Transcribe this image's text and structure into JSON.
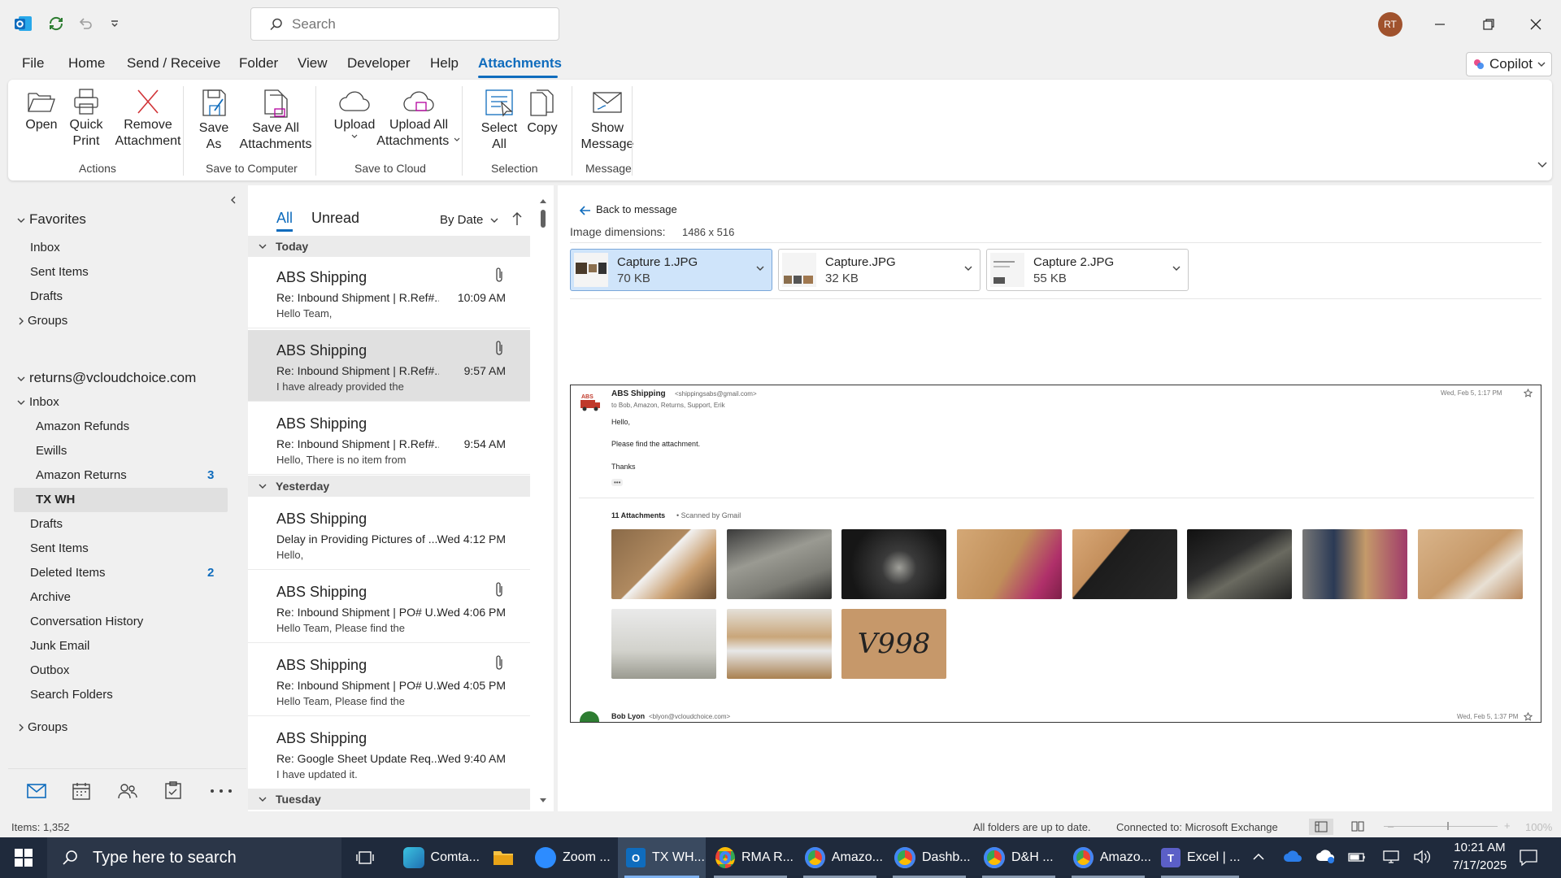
{
  "title_bar": {
    "search_placeholder": "Search",
    "avatar_initials": "RT"
  },
  "menu": {
    "items": [
      "File",
      "Home",
      "Send / Receive",
      "Folder",
      "View",
      "Developer",
      "Help",
      "Attachments"
    ],
    "active": "Attachments",
    "copilot_label": "Copilot"
  },
  "ribbon": {
    "groups": [
      {
        "label": "Actions",
        "buttons": [
          "Open",
          "Quick Print",
          "Remove Attachment"
        ]
      },
      {
        "label": "Save to Computer",
        "buttons": [
          "Save As",
          "Save All Attachments"
        ]
      },
      {
        "label": "Save to Cloud",
        "buttons": [
          "Upload",
          "Upload All Attachments"
        ]
      },
      {
        "label": "Selection",
        "buttons": [
          "Select All",
          "Copy"
        ]
      },
      {
        "label": "Message",
        "buttons": [
          "Show Message"
        ]
      }
    ],
    "btn_open_l1": "Open",
    "btn_quickprint_l1": "Quick",
    "btn_quickprint_l2": "Print",
    "btn_remove_l1": "Remove",
    "btn_remove_l2": "Attachment",
    "btn_saveas_l1": "Save",
    "btn_saveas_l2": "As",
    "btn_saveall_l1": "Save All",
    "btn_saveall_l2": "Attachments",
    "btn_upload_l1": "Upload",
    "btn_uploadall_l1": "Upload All",
    "btn_uploadall_l2": "Attachments",
    "btn_selectall_l1": "Select",
    "btn_selectall_l2": "All",
    "btn_copy_l1": "Copy",
    "btn_showmsg_l1": "Show",
    "btn_showmsg_l2": "Message",
    "group_actions": "Actions",
    "group_save_computer": "Save to Computer",
    "group_save_cloud": "Save to Cloud",
    "group_selection": "Selection",
    "group_message": "Message"
  },
  "nav": {
    "favorites_label": "Favorites",
    "fav_inbox": "Inbox",
    "fav_sent": "Sent Items",
    "fav_drafts": "Drafts",
    "groups_label": "Groups",
    "account": "returns@vcloudchoice.com",
    "inbox": "Inbox",
    "amazon_refunds": "Amazon Refunds",
    "ewills": "Ewills",
    "amazon_returns": "Amazon Returns",
    "amazon_returns_count": "3",
    "tx_wh": "TX WH",
    "drafts": "Drafts",
    "sent_items": "Sent Items",
    "deleted_items": "Deleted Items",
    "deleted_items_count": "2",
    "archive": "Archive",
    "conversation_history": "Conversation History",
    "junk_email": "Junk Email",
    "outbox": "Outbox",
    "search_folders": "Search Folders",
    "groups2_label": "Groups"
  },
  "message_list": {
    "tab_all": "All",
    "tab_unread": "Unread",
    "sort_label": "By Date",
    "group_today": "Today",
    "group_yesterday": "Yesterday",
    "group_tuesday": "Tuesday",
    "messages": [
      {
        "sender": "ABS Shipping",
        "subject": "Re: Inbound Shipment | R.Ref#...",
        "time": "10:09 AM",
        "preview": "Hello Team,",
        "attachment": true
      },
      {
        "sender": "ABS Shipping",
        "subject": "Re: Inbound Shipment | R.Ref#...",
        "time": "9:57 AM",
        "preview": "I have already provided the",
        "attachment": true
      },
      {
        "sender": "ABS Shipping",
        "subject": "Re: Inbound Shipment | R.Ref#...",
        "time": "9:54 AM",
        "preview": "Hello,  There is no item from",
        "attachment": false
      },
      {
        "sender": "ABS Shipping",
        "subject": "Delay in Providing Pictures of ...",
        "time": "Wed 4:12 PM",
        "preview": "Hello,",
        "attachment": false
      },
      {
        "sender": "ABS Shipping",
        "subject": "Re: Inbound Shipment | PO# U...",
        "time": "Wed 4:06 PM",
        "preview": "Hello Team,  Please find the",
        "attachment": true
      },
      {
        "sender": "ABS Shipping",
        "subject": "Re: Inbound Shipment | PO# U...",
        "time": "Wed 4:05 PM",
        "preview": "Hello Team,  Please find the",
        "attachment": true
      },
      {
        "sender": "ABS Shipping",
        "subject": "Re: Google Sheet Update Req...",
        "time": "Wed 9:40 AM",
        "preview": "I have updated it.",
        "attachment": false
      }
    ]
  },
  "reading_pane": {
    "back_label": "Back to message",
    "dimensions_label": "Image dimensions:",
    "dimensions_value": "1486 x 516",
    "attachments": [
      {
        "name": "Capture 1.JPG",
        "size": "70 KB",
        "selected": true
      },
      {
        "name": "Capture.JPG",
        "size": "32 KB",
        "selected": false
      },
      {
        "name": "Capture 2.JPG",
        "size": "55 KB",
        "selected": false
      }
    ],
    "preview": {
      "sender": "ABS Shipping",
      "sender_email": "<shippingsabs@gmail.com>",
      "to_line": "to Bob, Amazon, Returns, Support, Erik",
      "date": "Wed, Feb 5, 1:17 PM",
      "line1": "Hello,",
      "line2": "Please find the attachment.",
      "line3": "Thanks",
      "ellipsis": "•••",
      "attach_count": "11 Attachments",
      "scanned": "• Scanned by Gmail",
      "label_text": "V998",
      "reply_sender": "Bob Lyon",
      "reply_email": "<blyon@vcloudchoice.com>",
      "reply_date": "Wed, Feb 5, 1:37 PM"
    }
  },
  "status_bar": {
    "items": "Items: 1,352",
    "sync": "All folders are up to date.",
    "connection": "Connected to: Microsoft Exchange",
    "zoom": "100%"
  },
  "taskbar": {
    "search_placeholder": "Type here to search",
    "apps": [
      "Comta...",
      "",
      "Zoom ...",
      "TX WH...",
      "RMA R...",
      "Amazo...",
      "Dashb...",
      "D&H ...",
      "Amazo...",
      "Excel | ..."
    ],
    "time": "10:21 AM",
    "date": "7/17/2025"
  },
  "colors": {
    "accent": "#0f6cbd",
    "remove_icon": "#d13438",
    "selected_attachment": "#cfe4fa",
    "taskbar": "#1f2a3c"
  }
}
